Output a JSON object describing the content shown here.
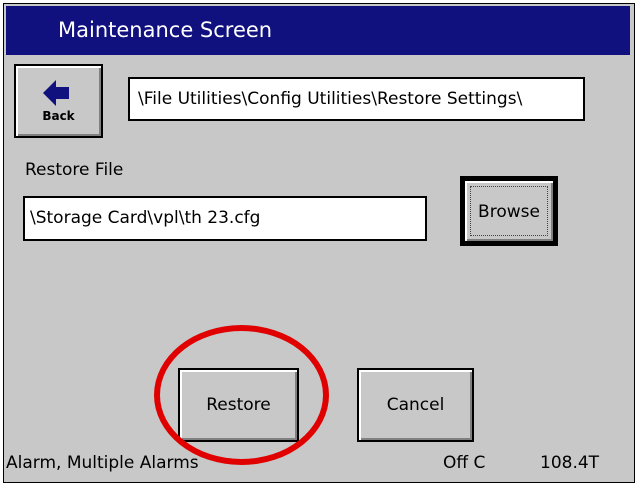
{
  "window": {
    "title": "Maintenance Screen"
  },
  "toolbar": {
    "back_label": "Back",
    "back_icon": "arrow-left-icon"
  },
  "path": {
    "value": "\\File Utilities\\Config Utilities\\Restore Settings\\"
  },
  "restore_file": {
    "label": "Restore File",
    "value": "\\Storage Card\\vpl\\th 23.cfg",
    "browse_label": "Browse"
  },
  "actions": {
    "restore_label": "Restore",
    "cancel_label": "Cancel"
  },
  "status": {
    "alarm": "Alarm, Multiple Alarms",
    "mode": "Off C",
    "value": "108.4T"
  },
  "colors": {
    "titlebar": "#10107e",
    "background": "#c8c8c8",
    "highlight": "#e00000"
  }
}
